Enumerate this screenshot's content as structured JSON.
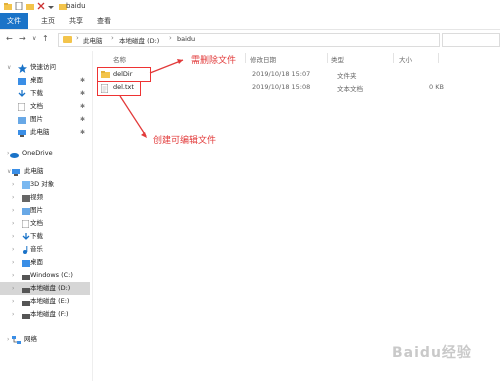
{
  "window": {
    "title": "baidu"
  },
  "ribbon": {
    "file_tab": "文件",
    "tabs": [
      "主页",
      "共享",
      "查看"
    ]
  },
  "address": {
    "crumbs": [
      "此电脑",
      "本地磁盘 (D:)",
      "baidu"
    ]
  },
  "columns": {
    "name": "名称",
    "date": "修改日期",
    "type": "类型",
    "size": "大小"
  },
  "files": [
    {
      "name": "delDir",
      "date": "2019/10/18 15:07",
      "type": "文件夹",
      "size": "",
      "icon": "folder-icon"
    },
    {
      "name": "del.txt",
      "date": "2019/10/18 15:08",
      "type": "文本文档",
      "size": "0 KB",
      "icon": "text-file-icon"
    }
  ],
  "sidebar": {
    "quick_access": "快速访问",
    "quick_items": [
      "桌面",
      "下载",
      "文档",
      "图片",
      "此电脑"
    ],
    "onedrive": "OneDrive",
    "this_pc": "此电脑",
    "pc_items": [
      "3D 对象",
      "视频",
      "图片",
      "文档",
      "下载",
      "音乐",
      "桌面",
      "Windows (C:)",
      "本地磁盘 (D:)",
      "本地磁盘 (E:)",
      "本地磁盘 (F:)"
    ],
    "network": "网络"
  },
  "annotations": {
    "delete": "需删除文件",
    "edit": "创建可编辑文件"
  },
  "watermark": "Baidu经验",
  "colors": {
    "accent": "#1a73c8",
    "annotation": "#e23a3a",
    "folder": "#f3c44b"
  }
}
